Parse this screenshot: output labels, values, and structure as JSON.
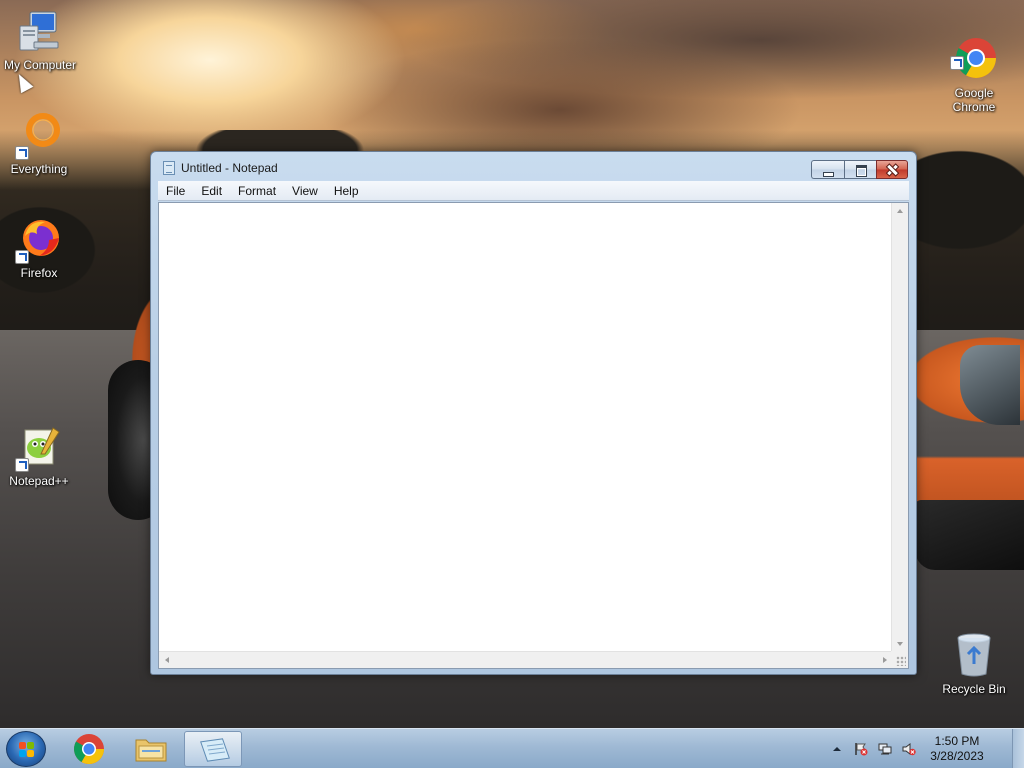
{
  "desktop": {
    "icons": [
      {
        "label": "My Computer",
        "icon": "computer-icon"
      },
      {
        "label": "Everything",
        "icon": "everything-search-icon"
      },
      {
        "label": "Firefox",
        "icon": "firefox-icon"
      },
      {
        "label": "Notepad++",
        "icon": "notepadpp-icon"
      },
      {
        "label": "Google\nChrome",
        "icon": "chrome-icon"
      },
      {
        "label": "Recycle Bin",
        "icon": "recycle-bin-icon"
      }
    ]
  },
  "notepad": {
    "title": "Untitled - Notepad",
    "menu": [
      "File",
      "Edit",
      "Format",
      "View",
      "Help"
    ],
    "content": ""
  },
  "taskbar": {
    "pinned": [
      {
        "name": "start-button",
        "icon": "windows-logo-icon"
      },
      {
        "name": "chrome",
        "icon": "chrome-icon"
      },
      {
        "name": "file-explorer",
        "icon": "folder-icon"
      },
      {
        "name": "notepad",
        "icon": "notepad-icon",
        "active": true
      }
    ],
    "tray": {
      "icons": [
        "show-hidden-icons-arrow",
        "action-center-flag-icon",
        "network-icon",
        "volume-muted-icon"
      ],
      "time": "1:50 PM",
      "date": "3/28/2023"
    }
  },
  "colors": {
    "taskbar": "#9fb9d4",
    "window_frame": "#b9cfe6",
    "close_button": "#c0392b"
  }
}
